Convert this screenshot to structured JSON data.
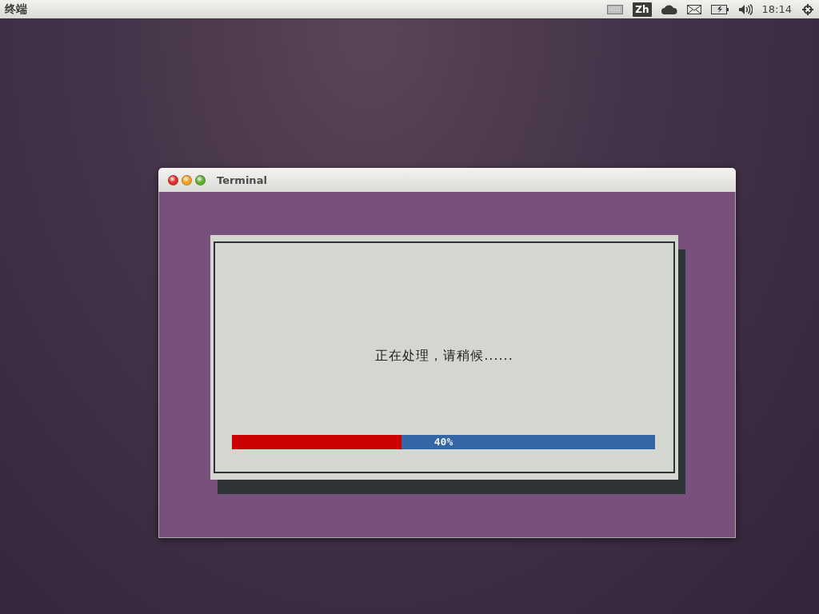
{
  "top_bar": {
    "app_title": "终端",
    "input_method": "Zh",
    "clock": "18:14"
  },
  "window": {
    "title": "Terminal",
    "dialog": {
      "message": "正在处理，请稍候......",
      "progress": {
        "level": 0.4,
        "label": "40%"
      }
    }
  }
}
